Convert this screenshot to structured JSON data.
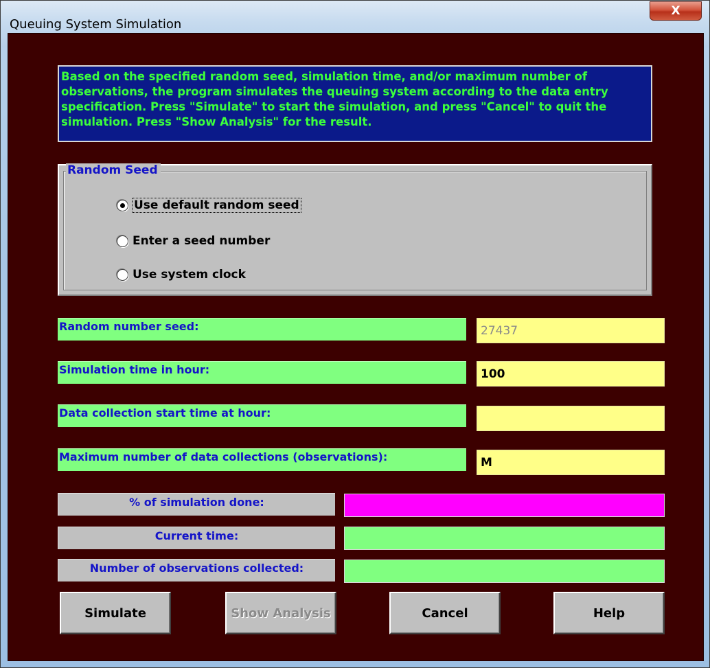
{
  "window": {
    "title": "Queuing System Simulation",
    "close_glyph": "X"
  },
  "info": {
    "text": "Based on the specified random seed, simulation time, and/or maximum number of observations, the program simulates the queuing system according to the data entry specification.  Press \"Simulate\" to start the simulation, and press \"Cancel\" to quit the simulation.  Press \"Show Analysis\" for the result."
  },
  "random_seed_group": {
    "title": "Random Seed",
    "options": [
      {
        "label": "Use default random seed",
        "selected": true
      },
      {
        "label": "Enter a seed number",
        "selected": false
      },
      {
        "label": "Use system clock",
        "selected": false
      }
    ]
  },
  "fields": {
    "seed_label": "Random number seed:",
    "seed_value": "27437",
    "sim_time_label": "Simulation time in hour:",
    "sim_time_value": "100",
    "start_time_label": "Data collection start time at hour:",
    "start_time_value": "",
    "max_obs_label": "Maximum number of data collections (observations):",
    "max_obs_value": "M"
  },
  "status": {
    "pct_label": "% of simulation done:",
    "current_time_label": "Current time:",
    "obs_label": "Number of observations collected:"
  },
  "buttons": {
    "simulate": "Simulate",
    "show_analysis": "Show Analysis",
    "cancel": "Cancel",
    "help": "Help"
  },
  "colors": {
    "client_bg": "#3c0000",
    "info_bg": "#0b1a8a",
    "info_text": "#3cff3c",
    "label_green": "#80ff80",
    "input_yellow": "#ffff88",
    "progress_magenta": "#ff00ff",
    "label_blue": "#1414c8"
  }
}
